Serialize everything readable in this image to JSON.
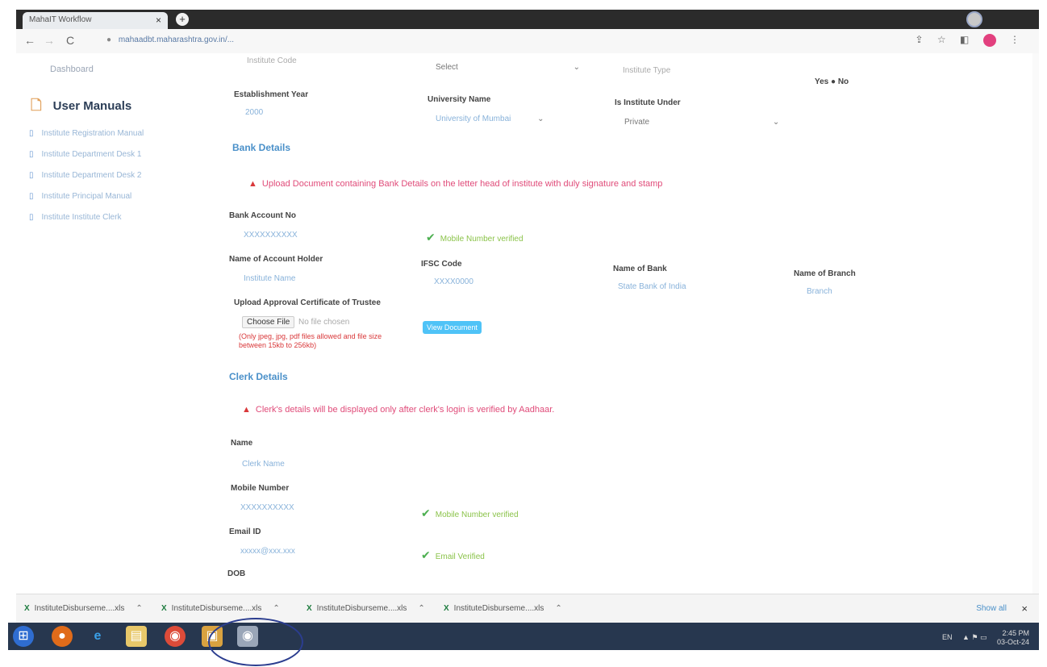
{
  "browser": {
    "tab_title": "MahaIT Workflow",
    "tab_close": "×",
    "new_tab": "+",
    "url": "mahaadbt.maharashtra.gov.in/...",
    "back": "←",
    "forward": "→",
    "reload": "C"
  },
  "sidebar": {
    "dashboard_link": "Dashboard",
    "title": "User Manuals",
    "items": [
      {
        "label": "Institute Registration Manual"
      },
      {
        "label": "Institute Department Desk 1"
      },
      {
        "label": "Institute Department Desk 2"
      },
      {
        "label": "Institute Principal Manual"
      },
      {
        "label": "Institute Institute Clerk"
      }
    ]
  },
  "form": {
    "top_field_value": "Institute Code",
    "top_dropdown_value": "Select",
    "top_right_value": "Institute Type",
    "yes_no": "Yes ● No",
    "establishment_year_label": "Establishment Year",
    "establishment_year_value": "2000",
    "university_label": "University Name",
    "university_value": "University of Mumbai",
    "institute_under_label": "Is Institute Under",
    "institute_under_value": "Private",
    "bank_section_title": "Bank Details",
    "bank_alert": "Upload Document containing Bank Details on the letter head of institute with duly signature and stamp",
    "bank_account_label": "Bank Account No",
    "bank_account_value": "XXXXXXXXXX",
    "bank_verified": "Mobile Number verified",
    "account_holder_label": "Name of Account Holder",
    "account_holder_value": "Institute Name",
    "ifsc_label": "IFSC Code",
    "ifsc_value": "XXXX0000",
    "bank_name_label": "Name of Bank",
    "bank_name_value": "State Bank of India",
    "branch_label": "Name of Branch",
    "branch_value": "Branch",
    "upload_label": "Upload Approval Certificate of Trustee",
    "choose_file": "Choose File",
    "no_file": "No file chosen",
    "file_note": "(Only jpeg, jpg, pdf files allowed and file size between 15kb to 256kb)",
    "view_document": "View Document",
    "clerk_section_title": "Clerk Details",
    "clerk_alert": "Clerk's details will be displayed only after clerk's login is verified by Aadhaar.",
    "name_label": "Name",
    "name_value": "Clerk Name",
    "mobile_label": "Mobile Number",
    "mobile_value": "XXXXXXXXXX",
    "mobile_verified": "Mobile Number verified",
    "email_label": "Email ID",
    "email_value": "xxxxx@xxx.xxx",
    "email_verified": "Email Verified",
    "dob_label": "DOB"
  },
  "downloads": {
    "items": [
      {
        "name": "InstituteDisburseme....xls"
      },
      {
        "name": "InstituteDisburseme....xls"
      },
      {
        "name": "InstituteDisburseme....xls"
      },
      {
        "name": "InstituteDisburseme....xls"
      }
    ],
    "show_all": "Show all",
    "close": "×"
  },
  "taskbar": {
    "lang": "EN",
    "time": "2:45 PM",
    "date": "03-Oct-24"
  },
  "colors": {
    "accent": "#4a90c9",
    "alert": "#e04b79",
    "verified": "#8bc34a",
    "taskbar": "#27374f"
  }
}
